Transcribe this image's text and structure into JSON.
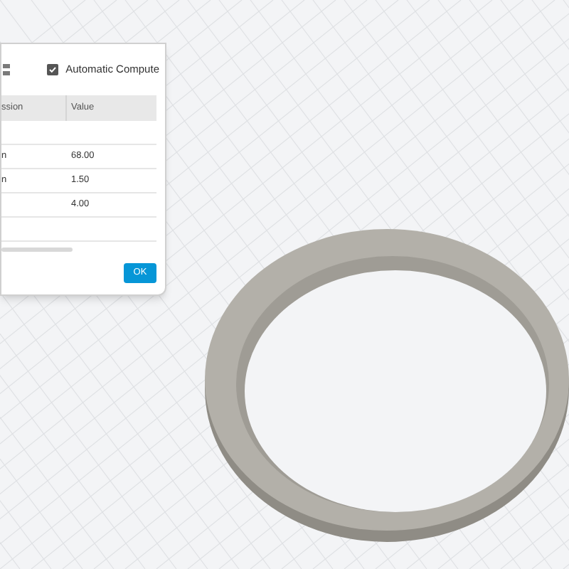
{
  "dialog": {
    "automatic_compute": {
      "label": "Automatic Compute",
      "checked": true
    },
    "table": {
      "columns": [
        "ssion",
        "Value"
      ],
      "rows": [
        {
          "column_1": "",
          "value": ""
        },
        {
          "column_1": "n",
          "value": "68.00"
        },
        {
          "column_1": "n",
          "value": "1.50"
        },
        {
          "column_1": "",
          "value": "4.00"
        },
        {
          "column_1": "",
          "value": ""
        }
      ]
    },
    "ok_button": "OK"
  }
}
